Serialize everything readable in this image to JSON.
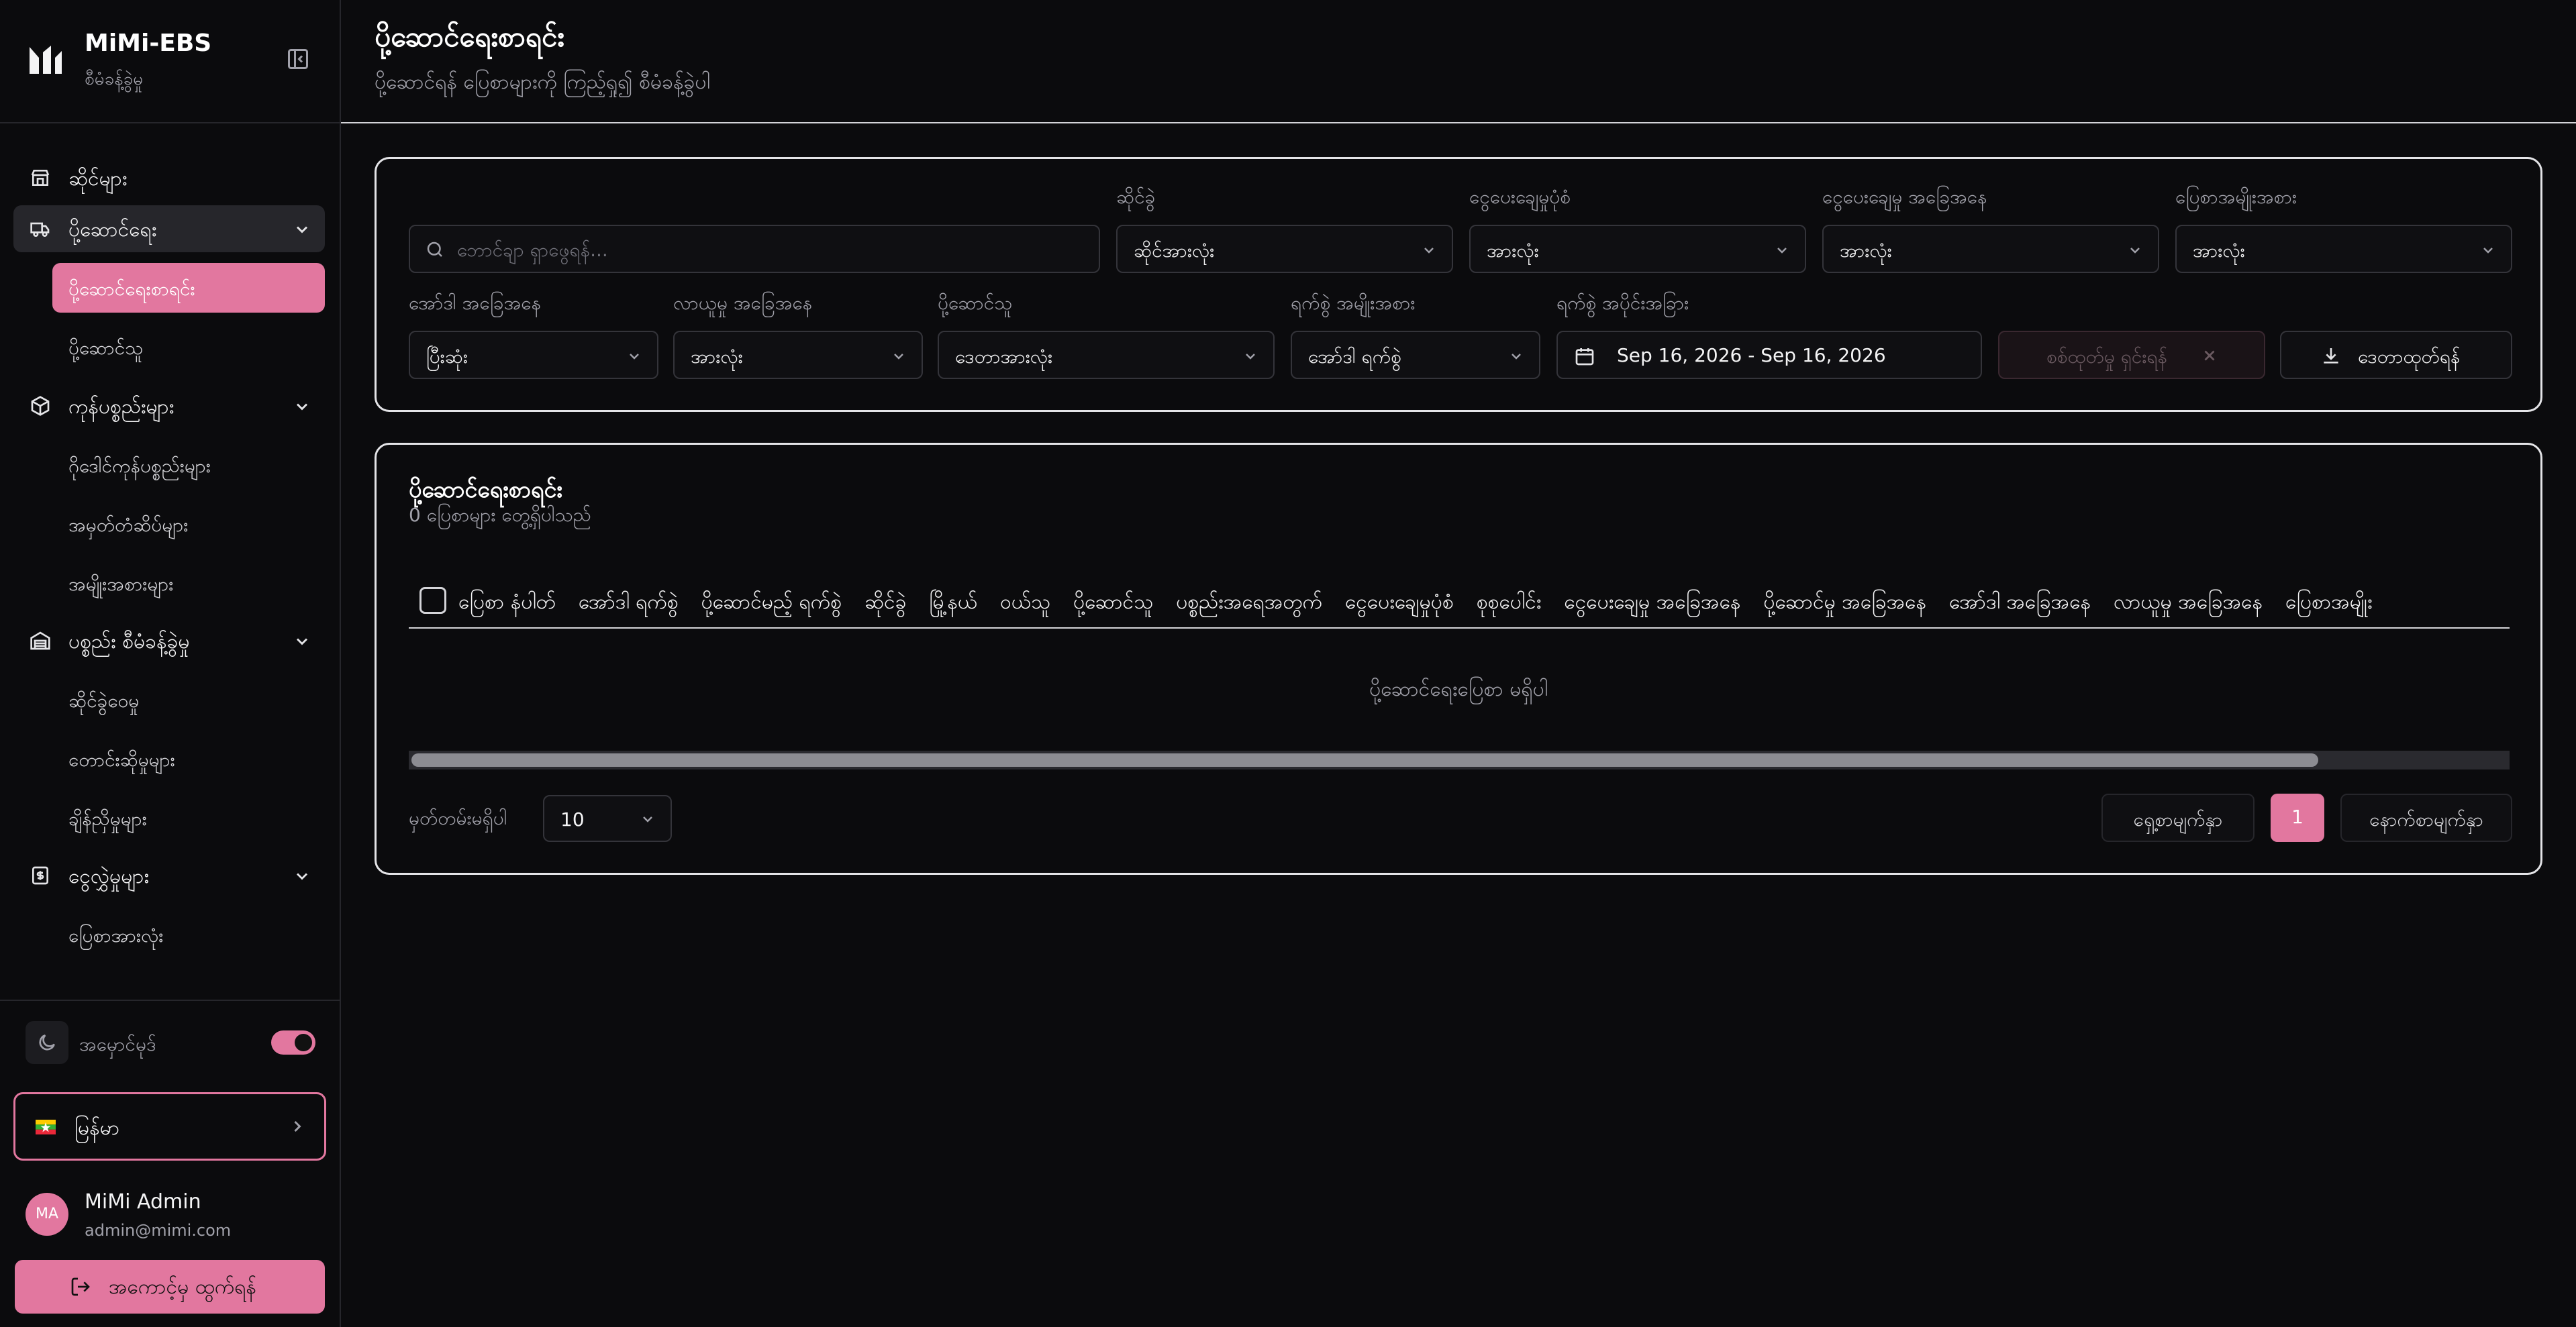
{
  "app": {
    "name": "MiMi-EBS",
    "subtitle": "စီမံခန့်ခွဲမှု",
    "accent_color": "#e2779f"
  },
  "sidebar": {
    "items": [
      {
        "label": "ဆိုင်များ",
        "icon": "store-icon"
      },
      {
        "label": "ပို့ဆောင်ရေး",
        "icon": "truck-icon",
        "expanded": true,
        "children": [
          {
            "label": "ပို့ဆောင်ရေးစာရင်း",
            "active": true
          },
          {
            "label": "ပို့ဆောင်သူ"
          }
        ]
      },
      {
        "label": "ကုန်ပစ္စည်းများ",
        "icon": "package-icon",
        "expanded": true,
        "children": [
          {
            "label": "ဂိုဒေါင်ကုန်ပစ္စည်းများ"
          },
          {
            "label": "အမှတ်တံဆိပ်များ"
          },
          {
            "label": "အမျိုးအစားများ"
          }
        ]
      },
      {
        "label": "ပစ္စည်း စီမံခန့်ခွဲမှု",
        "icon": "warehouse-icon",
        "expanded": true,
        "children": [
          {
            "label": "ဆိုင်ခွဲဝေမှု"
          },
          {
            "label": "တောင်းဆိုမှုများ"
          },
          {
            "label": "ချိန်ညှိမှုများ"
          }
        ]
      },
      {
        "label": "ငွေလွှဲမှုများ",
        "icon": "receipt-icon",
        "expanded": true,
        "children": [
          {
            "label": "ပြေစာအားလုံး"
          }
        ]
      }
    ],
    "theme_label": "အမှောင်မုဒ်",
    "dark_mode": true,
    "language": {
      "label": "မြန်မာ",
      "flag_icon": "myanmar-flag-icon"
    },
    "user": {
      "initials": "MA",
      "name": "MiMi Admin",
      "email": "admin@mimi.com"
    },
    "logout_label": "အကောင့်မှ ထွက်ရန်"
  },
  "page": {
    "title": "ပို့ဆောင်ရေးစာရင်း",
    "subtitle": "ပို့ဆောင်ရန် ပြေစာများကို ကြည့်ရှု၍ စီမံခန့်ခွဲပါ"
  },
  "filters": {
    "search_placeholder": "ဘောင်ချာ ရှာဖွေရန်...",
    "branch": {
      "label": "ဆိုင်ခွဲ",
      "value": "ဆိုင်အားလုံး"
    },
    "payment_type": {
      "label": "ငွေပေးချေမှုပုံစံ",
      "value": "အားလုံး"
    },
    "payment_status": {
      "label": "ငွေပေးချေမှု အခြေအနေ",
      "value": "အားလုံး"
    },
    "invoice_type": {
      "label": "ပြေစာအမျိုးအစား",
      "value": "အားလုံး"
    },
    "order_status": {
      "label": "အော်ဒါ အခြေအနေ",
      "value": "ပြီးဆုံး"
    },
    "transfer_status": {
      "label": "လာယူမှု အခြေအနေ",
      "value": "အားလုံး"
    },
    "deliverer": {
      "label": "ပို့ဆောင်သူ",
      "value": "ဒေတာအားလုံး"
    },
    "date_type": {
      "label": "ရက်စွဲ အမျိုးအစား",
      "value": "အော်ဒါ ရက်စွဲ"
    },
    "date_range": {
      "label": "ရက်စွဲ အပိုင်းအခြား",
      "value": "Sep 16, 2026 - Sep 16, 2026"
    },
    "clear_label": "စစ်ထုတ်မှု ရှင်းရန်",
    "export_label": "ဒေတာထုတ်ရန်"
  },
  "table": {
    "title": "ပို့ဆောင်ရေးစာရင်း",
    "count_text": "0 ပြေစာများ တွေ့ရှိပါသည်",
    "columns": [
      "ပြေစာ နံပါတ်",
      "အော်ဒါ ရက်စွဲ",
      "ပို့ဆောင်မည့် ရက်စွဲ",
      "ဆိုင်ခွဲ",
      "မြို့နယ်",
      "ဝယ်သူ",
      "ပို့ဆောင်သူ",
      "ပစ္စည်းအရေအတွက်",
      "ငွေပေးချေမှုပုံစံ",
      "စုစုပေါင်း",
      "ငွေပေးချေမှု အခြေအနေ",
      "ပို့ဆောင်မှု အခြေအနေ",
      "အော်ဒါ အခြေအနေ",
      "လာယူမှု အခြေအနေ",
      "ပြေစာအမျိုး"
    ],
    "empty_text": "ပို့ဆောင်ရေးပြေစာ မရှိပါ",
    "scroll_fraction": 0.91
  },
  "pagination": {
    "rows_per_page_label": "မှတ်တမ်းမရှိပါ",
    "rows_per_page": "10",
    "prev_label": "ရှေ့စာမျက်နှာ",
    "current_page": "1",
    "next_label": "နောက်စာမျက်နှာ"
  }
}
